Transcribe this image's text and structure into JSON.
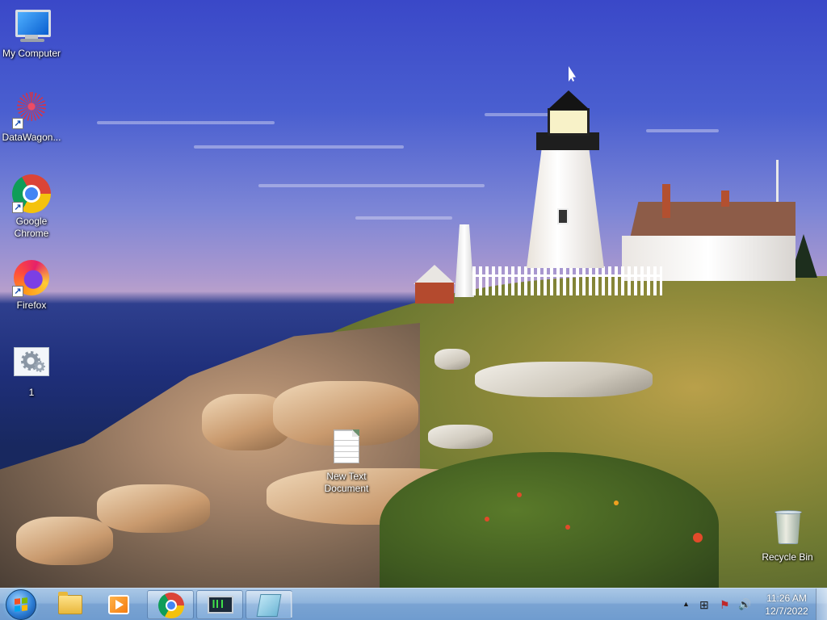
{
  "desktop": {
    "icons": [
      {
        "label": "My Computer",
        "icon": "computer-icon"
      },
      {
        "label": "DataWagon...",
        "icon": "datawagon-icon",
        "shortcut": true
      },
      {
        "label": "Google Chrome",
        "icon": "chrome-icon",
        "shortcut": true
      },
      {
        "label": "Firefox",
        "icon": "firefox-icon",
        "shortcut": true
      },
      {
        "label": "1",
        "icon": "settings-image-icon"
      },
      {
        "label": "New Text Document",
        "icon": "text-document-icon"
      },
      {
        "label": "Recycle Bin",
        "icon": "recycle-bin-icon"
      }
    ]
  },
  "taskbar": {
    "start": {
      "icon": "windows-start-icon"
    },
    "buttons": [
      {
        "name": "file-explorer",
        "icon": "folder-icon",
        "running": false
      },
      {
        "name": "media-player",
        "icon": "media-player-icon",
        "running": false
      },
      {
        "name": "google-chrome",
        "icon": "chrome-icon",
        "running": true
      },
      {
        "name": "task-manager",
        "icon": "task-manager-icon",
        "running": true
      },
      {
        "name": "notepad",
        "icon": "notepad-icon",
        "running": true
      }
    ],
    "tray": {
      "overflow_glyph": "▲",
      "icons": [
        "network-icon",
        "action-center-flag-icon",
        "volume-icon"
      ],
      "network_glyph": "⊞",
      "flag_glyph": "⚑",
      "volume_glyph": "🔊",
      "time": "11:26 AM",
      "date": "12/7/2022"
    }
  }
}
